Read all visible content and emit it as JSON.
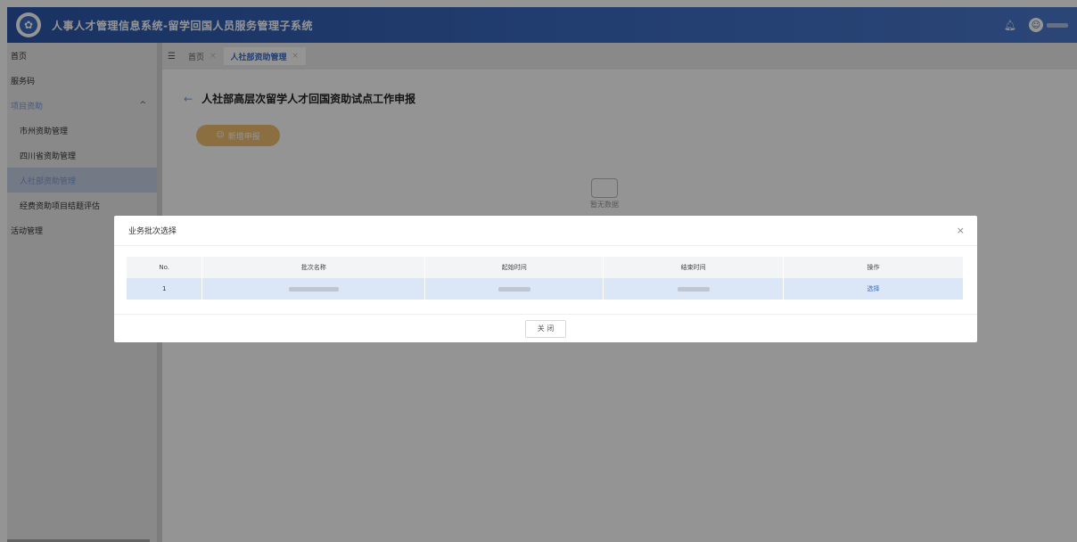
{
  "header": {
    "title": "人事人才管理信息系统-留学回国人员服务管理子系统",
    "logo_icon": "logo-emblem",
    "bell_icon": "bell-icon",
    "user_icon": "user-avatar-icon"
  },
  "sidebar": {
    "items": [
      {
        "label": "首页"
      },
      {
        "label": "服务码"
      },
      {
        "label": "项目资助"
      },
      {
        "label": "市州资助管理"
      },
      {
        "label": "四川省资助管理"
      },
      {
        "label": "人社部资助管理"
      },
      {
        "label": "经费资助项目结题评估"
      },
      {
        "label": "活动管理"
      }
    ]
  },
  "tabs": [
    {
      "label": "首页"
    },
    {
      "label": "人社部资助管理"
    }
  ],
  "tab_close": "×",
  "page": {
    "title": "人社部高层次留学人才回国资助试点工作申报",
    "add_button": "新增申报",
    "empty_text": "暂无数据"
  },
  "modal": {
    "title": "业务批次选择",
    "close_glyph": "×",
    "columns": [
      "No.",
      "批次名称",
      "起始时间",
      "结束时间",
      "操作"
    ],
    "rows": [
      {
        "no": "1",
        "action": "选择"
      }
    ],
    "close_button": "关 闭"
  },
  "colors": {
    "header": "#2b57a8",
    "accent": "#3d6cc3",
    "add_button": "#f0c070",
    "selected_row": "#dbe6f6"
  }
}
